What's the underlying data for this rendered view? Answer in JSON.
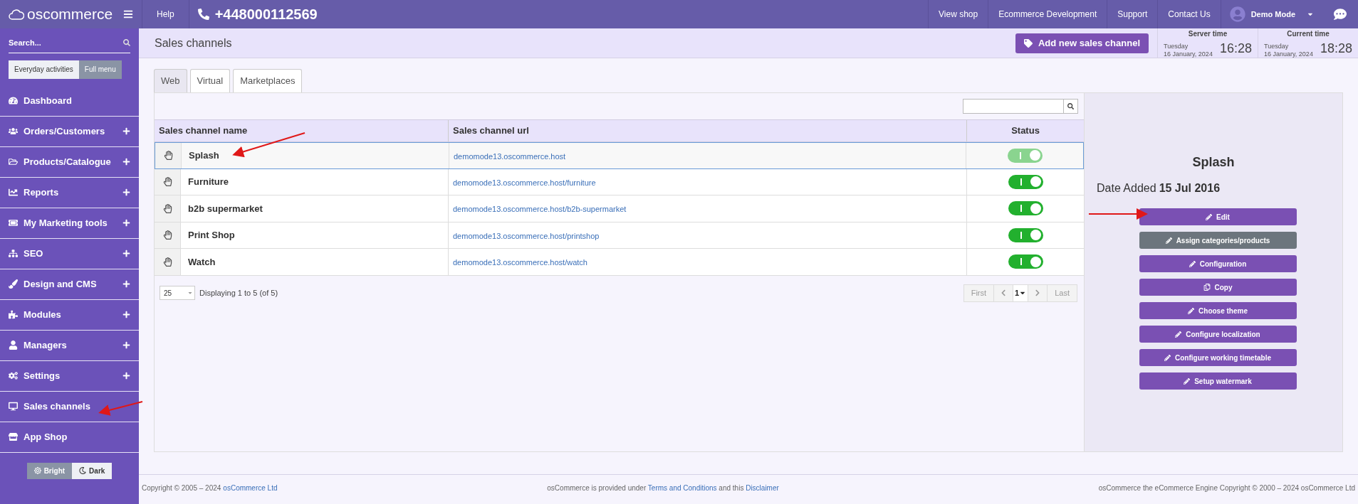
{
  "topbar": {
    "logo": "oscommerce",
    "help": "Help",
    "phone": "+448000112569",
    "links": [
      "View shop",
      "Ecommerce Development",
      "Support",
      "Contact Us"
    ],
    "user": "Demo Mode"
  },
  "sidebar": {
    "search_placeholder": "Search...",
    "modes": [
      {
        "label": "Everyday activities",
        "selected": false
      },
      {
        "label": "Full menu",
        "selected": true
      }
    ],
    "items": [
      {
        "label": "Dashboard",
        "expandable": false
      },
      {
        "label": "Orders/Customers",
        "expandable": true
      },
      {
        "label": "Products/Catalogue",
        "expandable": true
      },
      {
        "label": "Reports",
        "expandable": true
      },
      {
        "label": "My Marketing tools",
        "expandable": true
      },
      {
        "label": "SEO",
        "expandable": true
      },
      {
        "label": "Design and CMS",
        "expandable": true
      },
      {
        "label": "Modules",
        "expandable": true
      },
      {
        "label": "Managers",
        "expandable": true
      },
      {
        "label": "Settings",
        "expandable": true
      },
      {
        "label": "Sales channels",
        "expandable": false
      },
      {
        "label": "App Shop",
        "expandable": false
      }
    ],
    "themes": [
      {
        "label": "Bright",
        "selected": true
      },
      {
        "label": "Dark",
        "selected": false
      }
    ]
  },
  "page": {
    "title": "Sales channels",
    "add_button": "Add new sales channel",
    "clocks": [
      {
        "label": "Server time",
        "day": "Tuesday",
        "date": "16 January, 2024",
        "time": "16:28"
      },
      {
        "label": "Current time",
        "day": "Tuesday",
        "date": "16 January, 2024",
        "time": "18:28"
      }
    ]
  },
  "tabs": [
    {
      "label": "Web",
      "selected": true
    },
    {
      "label": "Virtual",
      "selected": false
    },
    {
      "label": "Marketplaces",
      "selected": false
    }
  ],
  "table": {
    "columns": [
      "Sales channel name",
      "Sales channel url",
      "Status"
    ],
    "rows": [
      {
        "name": "Splash",
        "url": "demomode13.oscommerce.host",
        "on": true,
        "selected": true
      },
      {
        "name": "Furniture",
        "url": "demomode13.oscommerce.host/furniture",
        "on": true,
        "selected": false
      },
      {
        "name": "b2b supermarket",
        "url": "demomode13.oscommerce.host/b2b-supermarket",
        "on": true,
        "selected": false
      },
      {
        "name": "Print Shop",
        "url": "demomode13.oscommerce.host/printshop",
        "on": true,
        "selected": false
      },
      {
        "name": "Watch",
        "url": "demomode13.oscommerce.host/watch",
        "on": true,
        "selected": false
      }
    ],
    "per_page": "25",
    "displaying": "Displaying 1 to 5 (of 5)",
    "pagination": {
      "first": "First",
      "page": "1",
      "last": "Last"
    }
  },
  "details": {
    "title": "Splash",
    "date_label": "Date Added",
    "date": "15 Jul 2016",
    "actions": [
      {
        "label": "Edit",
        "kind": "edit",
        "disabled": false
      },
      {
        "label": "Assign categories/products",
        "kind": "edit",
        "disabled": true
      },
      {
        "label": "Configuration",
        "kind": "edit",
        "disabled": false
      },
      {
        "label": "Copy",
        "kind": "copy",
        "disabled": false
      },
      {
        "label": "Choose theme",
        "kind": "edit",
        "disabled": false
      },
      {
        "label": "Configure localization",
        "kind": "edit",
        "disabled": false
      },
      {
        "label": "Configure working timetable",
        "kind": "edit",
        "disabled": false
      },
      {
        "label": "Setup watermark",
        "kind": "edit",
        "disabled": false
      }
    ]
  },
  "footer": {
    "left": "Copyright © 2005 – 2024",
    "left_link": "osCommerce Ltd",
    "middle": [
      "osCommerce is provided under ",
      "Terms and Conditions",
      " and this ",
      "Disclaimer"
    ],
    "right": "osCommerce the eCommerce Engine Copyright © 2000 – 2024 osCommerce Ltd"
  }
}
